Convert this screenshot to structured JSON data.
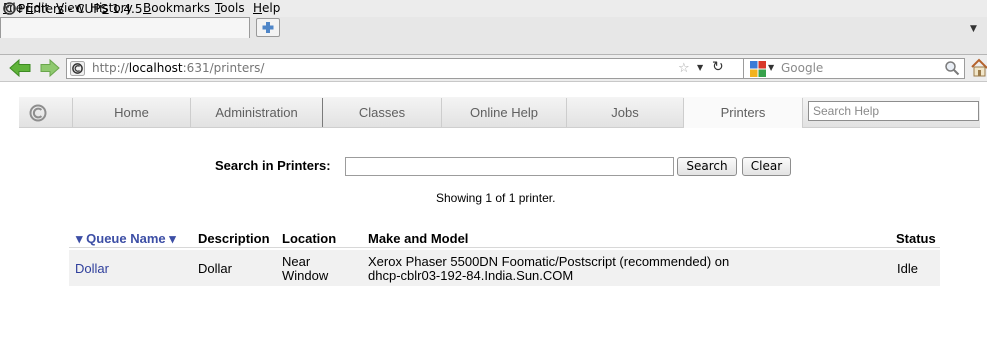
{
  "menubar": {
    "items": [
      {
        "pre": "",
        "ul": "F",
        "post": "ile"
      },
      {
        "pre": "",
        "ul": "E",
        "post": "dit"
      },
      {
        "pre": "",
        "ul": "V",
        "post": "iew"
      },
      {
        "pre": "Hi",
        "ul": "s",
        "post": "tory"
      },
      {
        "pre": "",
        "ul": "B",
        "post": "ookmarks"
      },
      {
        "pre": "",
        "ul": "T",
        "post": "ools"
      },
      {
        "pre": "",
        "ul": "H",
        "post": "elp"
      }
    ]
  },
  "tab": {
    "title": "Printers - CUPS 1.4.5"
  },
  "urlbar": {
    "prefix": "http://",
    "host": "localhost",
    "rest": ":631/printers/"
  },
  "searchbar": {
    "placeholder": "Google"
  },
  "cups_nav": {
    "items": [
      "Home",
      "Administration",
      "Classes",
      "Online Help",
      "Jobs",
      "Printers"
    ],
    "search_placeholder": "Search Help"
  },
  "search": {
    "label": "Search in Printers:",
    "value": "",
    "search_button": "Search",
    "clear_button": "Clear",
    "showing_text": "Showing 1 of 1 printer."
  },
  "table": {
    "headers": {
      "queue_name": "▾ Queue Name ▾",
      "description": "Description",
      "location": "Location",
      "make_model": "Make and Model",
      "status": "Status"
    },
    "rows": [
      {
        "queue_name": "Dollar",
        "description": "Dollar",
        "location_line1": "Near",
        "location_line2": "Window",
        "make_model_line1": "Xerox Phaser 5500DN Foomatic/Postscript (recommended) on",
        "make_model_line2": "dhcp-cblr03-192-84.India.Sun.COM",
        "status": "Idle"
      }
    ]
  },
  "colors": {
    "link": "#2f3f9c",
    "header_link": "#3c4ea5",
    "nav_text": "#5f5f5f",
    "arrow_green": "#5fb33a"
  }
}
